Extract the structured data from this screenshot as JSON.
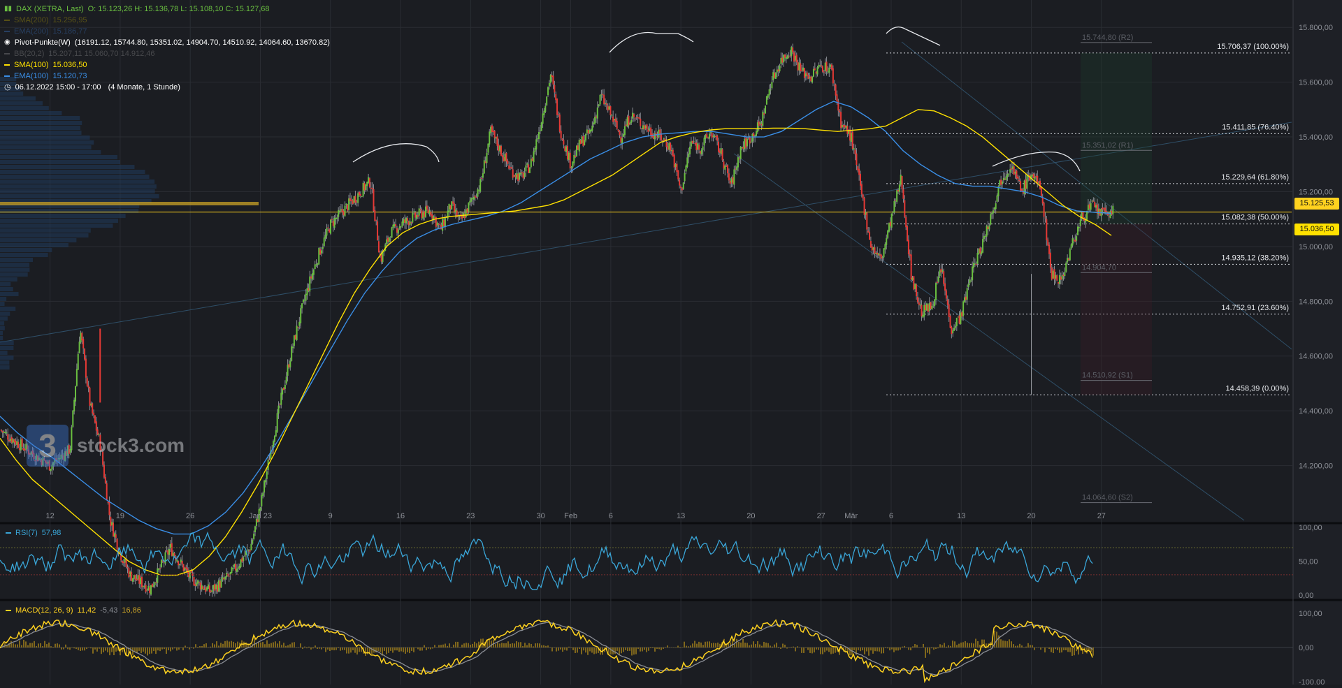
{
  "legend": {
    "instrument": "DAX (XETRA, Last)",
    "ohlc": "O: 15.123,26  H: 15.136,78  L: 15.108,10  C: 15.127,68",
    "sma200": {
      "label": "SMA(200)",
      "value": "15.256,95",
      "color": "#c9b300"
    },
    "ema200": {
      "label": "EMA(200)",
      "value": "15.186,77",
      "color": "#3f7fd6"
    },
    "pivot": {
      "label": "Pivot-Punkte(W)",
      "value": "(16191.12,  15744.80,  15351.02,  14904.70,  14510.92,  14064.60,  13670.82)"
    },
    "bb": {
      "label": "BB(20,2)",
      "value": "15.207,11  15.060,70  14.912,46"
    },
    "sma100": {
      "label": "SMA(100)",
      "value": "15.036,50",
      "color": "#ffe100"
    },
    "ema100": {
      "label": "EMA(100)",
      "value": "15.120,73",
      "color": "#3a8ee6"
    },
    "timeframe": "06.12.2022 15:00 - 17:00",
    "period": "(4 Monate, 1 Stunde)"
  },
  "watermark": "stock3.com",
  "watermark_logo": "3",
  "price_labels": {
    "last": "15.125,53",
    "sma": "15.036,50"
  },
  "rsi": {
    "label": "RSI(7)",
    "value": "57,98",
    "color": "#3aa6d8"
  },
  "macd": {
    "label": "MACD(12, 26, 9)",
    "v1": "11,42",
    "v2": "-5,43",
    "v3": "16,86",
    "color": "#ffd21f"
  },
  "chart_data": [
    {
      "type": "candlestick",
      "title": "DAX (XETRA, Last)",
      "ylim": [
        14000,
        15900
      ],
      "y_ticks": [
        "15.800,00",
        "15.600,00",
        "15.400,00",
        "15.200,00",
        "15.000,00",
        "14.800,00",
        "14.600,00",
        "14.400,00",
        "14.200,00"
      ],
      "y_tick_values": [
        15800,
        15600,
        15400,
        15200,
        15000,
        14800,
        14600,
        14400,
        14200
      ],
      "x_ticks": [
        "12",
        "19",
        "26",
        "Jan 23",
        "9",
        "16",
        "23",
        "30",
        "Feb",
        "6",
        "13",
        "20",
        "27",
        "Mär",
        "6",
        "13",
        "20",
        "27"
      ],
      "x_tick_values": [
        2,
        9,
        16,
        23,
        30,
        37,
        44,
        51,
        54,
        58,
        65,
        72,
        79,
        82,
        86,
        93,
        100,
        107
      ],
      "xlim": [
        -3,
        126
      ],
      "price_path_x": [
        -3,
        0,
        2,
        4,
        5,
        6,
        7,
        8,
        9,
        10,
        12,
        14,
        16,
        18,
        20,
        22,
        23,
        24,
        25,
        26,
        27,
        28,
        29,
        30,
        31,
        32,
        33,
        34,
        35,
        36,
        37,
        38,
        39,
        40,
        41,
        42,
        43,
        44,
        45,
        46,
        47,
        48,
        49,
        50,
        51,
        52,
        53,
        54,
        55,
        56,
        57,
        58,
        59,
        60,
        61,
        62,
        63,
        64,
        65,
        66,
        67,
        68,
        69,
        70,
        71,
        72,
        73,
        74,
        75,
        76,
        77,
        78,
        79,
        80,
        81,
        82,
        83,
        84,
        85,
        86,
        87,
        88,
        89,
        90,
        91,
        92,
        93,
        94,
        95,
        96,
        97,
        98,
        99,
        100,
        101,
        102,
        103,
        104,
        105,
        106,
        107,
        108
      ],
      "price_path_y": [
        14330,
        14250,
        14200,
        14260,
        14700,
        14420,
        14280,
        14000,
        13880,
        13800,
        13750,
        13900,
        13790,
        13740,
        13800,
        13900,
        14050,
        14250,
        14430,
        14600,
        14750,
        14880,
        14990,
        15080,
        15120,
        15160,
        15200,
        15240,
        14950,
        15050,
        15080,
        15100,
        15120,
        15130,
        15060,
        15150,
        15090,
        15160,
        15230,
        15420,
        15350,
        15280,
        15250,
        15300,
        15450,
        15630,
        15420,
        15300,
        15380,
        15420,
        15550,
        15480,
        15400,
        15480,
        15450,
        15420,
        15400,
        15360,
        15200,
        15380,
        15360,
        15420,
        15340,
        15220,
        15360,
        15400,
        15450,
        15600,
        15680,
        15720,
        15640,
        15620,
        15660,
        15650,
        15450,
        15400,
        15200,
        15000,
        14950,
        15100,
        15250,
        14900,
        14760,
        14780,
        14920,
        14700,
        14750,
        14900,
        15000,
        15120,
        15250,
        15300,
        15200,
        15270,
        15200,
        14900,
        14880,
        15000,
        15100,
        15150,
        15120,
        15127
      ],
      "sma100_y": [
        14300,
        14220,
        14150,
        14100,
        14050,
        14000,
        13950,
        13900,
        13850,
        13820,
        13800,
        13800,
        13820,
        13870,
        13940,
        14030,
        14130,
        14240,
        14360,
        14480,
        14600,
        14720,
        14830,
        14920,
        15000,
        15050,
        15080,
        15100,
        15110,
        15115,
        15120,
        15125,
        15130,
        15140,
        15150,
        15170,
        15200,
        15230,
        15260,
        15300,
        15340,
        15380,
        15400,
        15415,
        15425,
        15430,
        15430,
        15430,
        15432,
        15432,
        15430,
        15425,
        15420,
        15425,
        15430,
        15440,
        15470,
        15500,
        15495,
        15470,
        15440,
        15400,
        15350,
        15300,
        15250,
        15200,
        15150,
        15110,
        15080,
        15040
      ],
      "ema100_y": [
        14380,
        14320,
        14270,
        14230,
        14180,
        14130,
        14080,
        14040,
        14000,
        13970,
        13950,
        13950,
        13980,
        14030,
        14100,
        14190,
        14290,
        14400,
        14510,
        14620,
        14730,
        14830,
        14910,
        14980,
        15030,
        15060,
        15080,
        15095,
        15110,
        15130,
        15160,
        15200,
        15240,
        15280,
        15320,
        15350,
        15380,
        15400,
        15410,
        15415,
        15420,
        15420,
        15410,
        15400,
        15400,
        15420,
        15460,
        15500,
        15530,
        15510,
        15470,
        15420,
        15350,
        15300,
        15260,
        15230,
        15220,
        15220,
        15210,
        15200,
        15180,
        15150,
        15130,
        15125,
        15121
      ],
      "fib_levels": [
        {
          "label": "15.706,37 (100.00%)",
          "value": 15706.37
        },
        {
          "label": "15.411,85 (76.40%)",
          "value": 15411.85
        },
        {
          "label": "15.229,64 (61.80%)",
          "value": 15229.64
        },
        {
          "label": "15.082,38 (50.00%)",
          "value": 15082.38
        },
        {
          "label": "14.935,12 (38.20%)",
          "value": 14935.12
        },
        {
          "label": "14.752,91 (23.60%)",
          "value": 14752.91
        },
        {
          "label": "14.458,39 (0.00%)",
          "value": 14458.39
        }
      ],
      "pivot_levels": [
        {
          "label": "15.744,80 (R2)",
          "value": 15744.8
        },
        {
          "label": "15.351,02 (R1)",
          "value": 15351.02
        },
        {
          "label": "14.904,70",
          "value": 14904.7
        },
        {
          "label": "14.510,92 (S1)",
          "value": 14510.92
        },
        {
          "label": "14.064,60 (S2)",
          "value": 14064.6
        }
      ],
      "last_price": 15125.53,
      "sma100_last": 15036.5,
      "grid": true,
      "colors": {
        "up": "#6abf40",
        "down": "#e53935",
        "sma100": "#ffe100",
        "ema100": "#3a8ee6",
        "fib": "#cfd2d8"
      }
    },
    {
      "type": "line",
      "title": "RSI(7)",
      "ylim": [
        0,
        100
      ],
      "y_ticks": [
        "100,00",
        "50,00",
        "0,00"
      ],
      "y_tick_values": [
        100,
        50,
        0
      ],
      "upper_band": 70,
      "lower_band": 30
    },
    {
      "type": "line",
      "title": "MACD(12, 26, 9)",
      "ylim": [
        -120,
        120
      ],
      "y_ticks": [
        "100,00",
        "0,00",
        "-100,00"
      ],
      "y_tick_values": [
        100,
        0,
        -100
      ]
    }
  ]
}
